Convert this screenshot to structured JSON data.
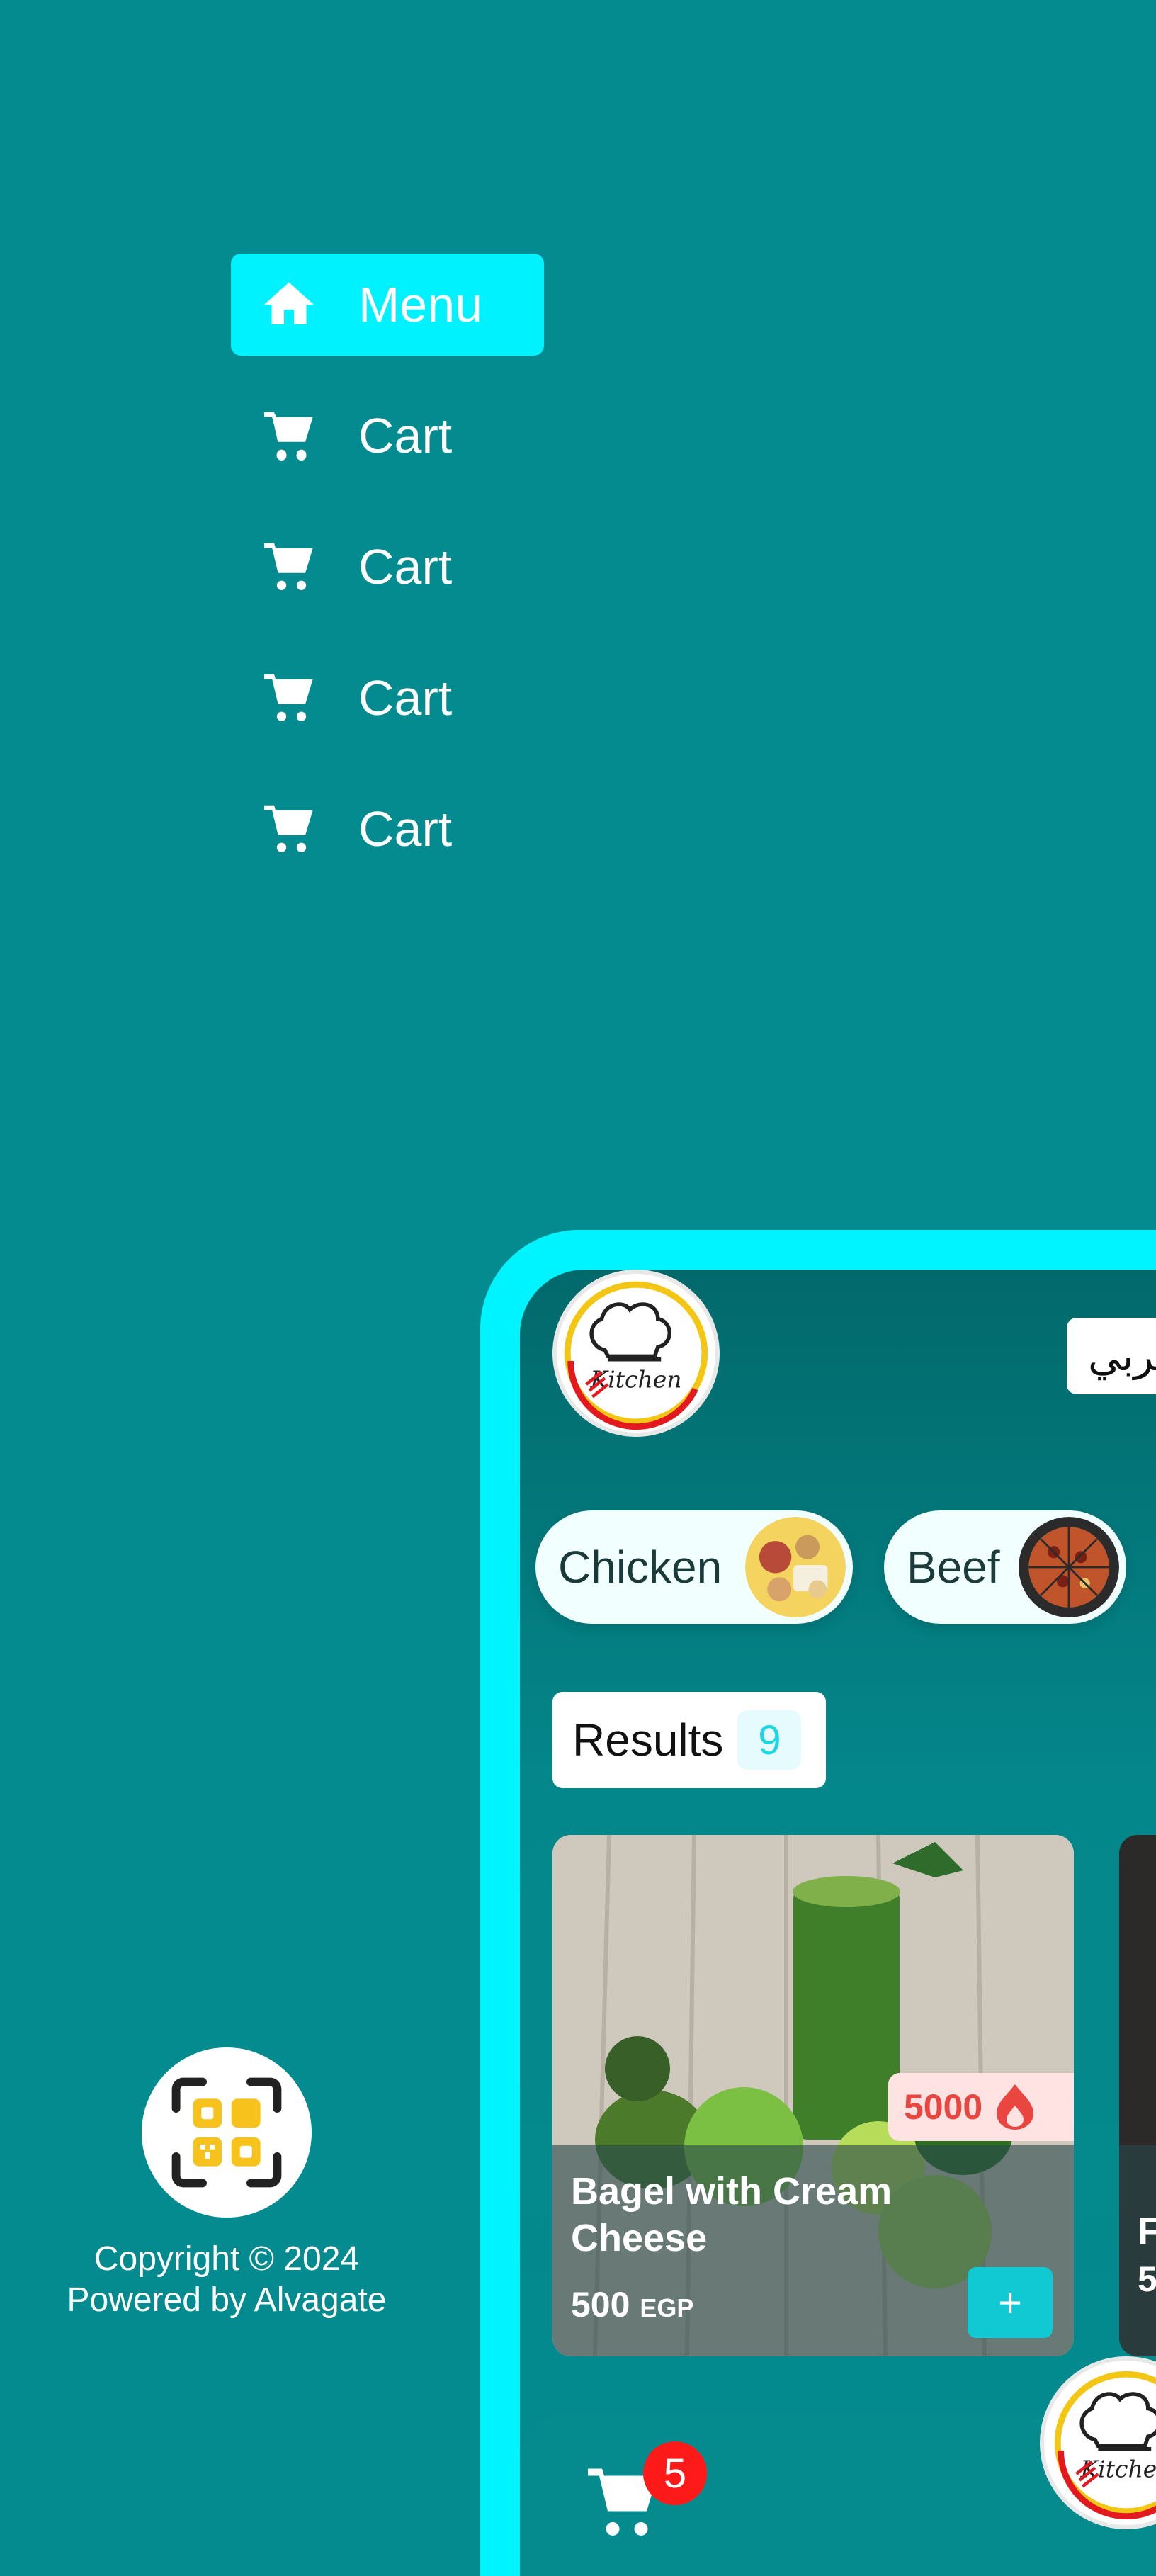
{
  "sidebar": {
    "items": [
      {
        "label": "Menu",
        "icon": "home-icon",
        "active": true
      },
      {
        "label": "Cart",
        "icon": "cart-icon"
      },
      {
        "label": "Cart",
        "icon": "cart-icon"
      },
      {
        "label": "Cart",
        "icon": "cart-icon"
      },
      {
        "label": "Cart",
        "icon": "cart-icon"
      }
    ]
  },
  "footer": {
    "icon": "qr-code-icon",
    "copyright": "Copyright © 2024",
    "powered_by": "Powered by Alvagate"
  },
  "app": {
    "logo_text": "Kitchen",
    "language_button": "عربي",
    "categories": [
      {
        "label": "Chicken",
        "icon": "chicken-dish-image"
      },
      {
        "label": "Beef",
        "icon": "pizza-image"
      }
    ],
    "results": {
      "label": "Results",
      "count": "9"
    },
    "products": [
      {
        "title": "Bagel with Cream Cheese",
        "price": "500",
        "currency": "EGP",
        "calories": "5000",
        "add_label": "+"
      },
      {
        "title": "F",
        "price": "5"
      }
    ],
    "cart": {
      "count": "5"
    }
  },
  "colors": {
    "background": "#038b8f",
    "accent": "#00f1ff",
    "badge": "#ff1a1a",
    "calories": "#e8463f",
    "qr_yellow": "#f7c21b"
  }
}
